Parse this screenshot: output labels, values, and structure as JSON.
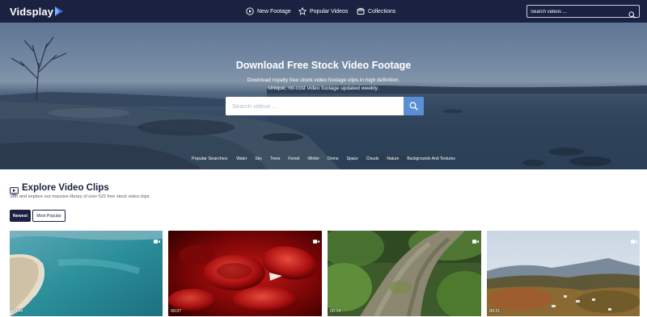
{
  "app": {
    "name": "Vidsplay"
  },
  "nav": {
    "links": [
      {
        "label": "New Footage",
        "icon": "play-circle-icon"
      },
      {
        "label": "Popular Videos",
        "icon": "star-icon"
      },
      {
        "label": "Collections",
        "icon": "folder-icon"
      }
    ],
    "search_placeholder": "Search videos ..."
  },
  "hero": {
    "title": "Download Free Stock Video Footage",
    "subtitle_line1": "Download royalty free stock video footage clips in high definition.",
    "subtitle_line2": "Unique, no-cost video footage updated weekly.",
    "search_placeholder": "Search videos ...",
    "popular_label": "Popular Searches:",
    "popular_tags": [
      "Water",
      "Sky",
      "Trees",
      "Forest",
      "Winter",
      "Drone",
      "Space",
      "Clouds",
      "Nature",
      "Backgrounds And Textures"
    ]
  },
  "explore": {
    "title": "Explore Video Clips",
    "subtitle": "Sort and explore our massive library of over 522 free stock video clips",
    "tabs": [
      {
        "label": "Newest",
        "active": true
      },
      {
        "label": "Most Popular",
        "active": false
      }
    ]
  },
  "videos": [
    {
      "duration": "00:44",
      "subject": "ocean-shoreline-aerial"
    },
    {
      "duration": "00:07",
      "subject": "red-blood-cells"
    },
    {
      "duration": "00:14",
      "subject": "mossy-log-forest"
    },
    {
      "duration": "00:31",
      "subject": "autumn-town-valley"
    }
  ],
  "colors": {
    "navy": "#1b2140",
    "accent_blue": "#5a8fd6"
  }
}
